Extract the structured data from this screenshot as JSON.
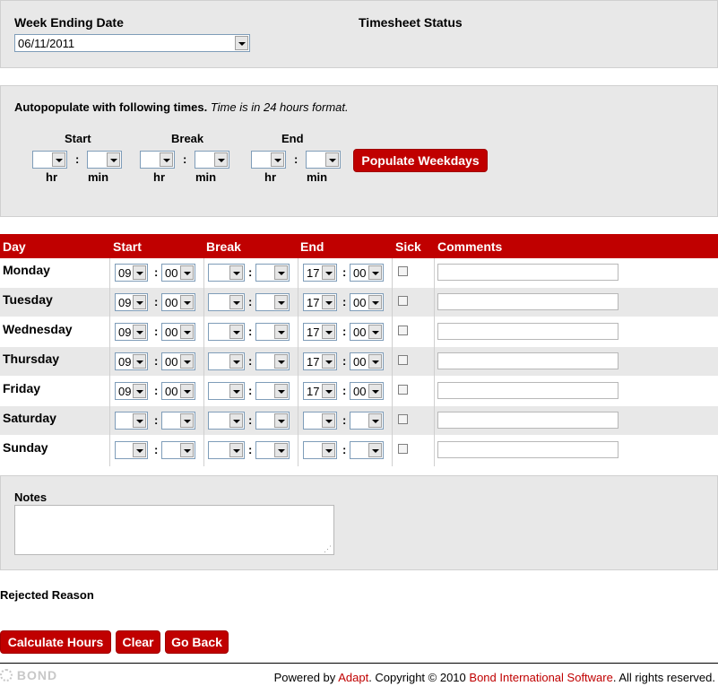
{
  "week": {
    "label": "Week Ending Date",
    "value": "06/11/2011",
    "status_label": "Timesheet Status"
  },
  "autopop": {
    "title": "Autopopulate with following times.",
    "note": "Time is in 24 hours format.",
    "groups": [
      "Start",
      "Break",
      "End"
    ],
    "hr": "hr",
    "min": "min",
    "button": "Populate Weekdays"
  },
  "table": {
    "headers": [
      "Day",
      "Start",
      "Break",
      "End",
      "Sick",
      "Comments"
    ],
    "rows": [
      {
        "day": "Monday",
        "start_h": "09",
        "start_m": "00",
        "end_h": "17",
        "end_m": "00"
      },
      {
        "day": "Tuesday",
        "start_h": "09",
        "start_m": "00",
        "end_h": "17",
        "end_m": "00"
      },
      {
        "day": "Wednesday",
        "start_h": "09",
        "start_m": "00",
        "end_h": "17",
        "end_m": "00"
      },
      {
        "day": "Thursday",
        "start_h": "09",
        "start_m": "00",
        "end_h": "17",
        "end_m": "00"
      },
      {
        "day": "Friday",
        "start_h": "09",
        "start_m": "00",
        "end_h": "17",
        "end_m": "00"
      },
      {
        "day": "Saturday",
        "start_h": "",
        "start_m": "",
        "end_h": "",
        "end_m": ""
      },
      {
        "day": "Sunday",
        "start_h": "",
        "start_m": "",
        "end_h": "",
        "end_m": ""
      }
    ],
    "colon": ":"
  },
  "notes": {
    "label": "Notes"
  },
  "rejected": {
    "label": "Rejected Reason"
  },
  "actions": {
    "calculate": "Calculate Hours",
    "clear": "Clear",
    "back": "Go Back"
  },
  "footer": {
    "logo": "BOND",
    "powered": "Powered by",
    "adapt": "Adapt",
    "copyright": ". Copyright © 2010",
    "company": "Bond International Software",
    "rights": ". All rights reserved."
  },
  "colors": {
    "accent": "#c00000",
    "panel": "#e8e8e8",
    "row_alt": "#e8e8e8"
  }
}
